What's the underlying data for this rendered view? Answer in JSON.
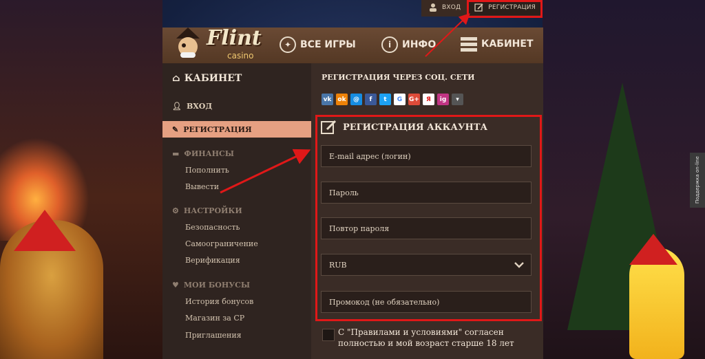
{
  "topbar": {
    "login": "ВХОД",
    "register": "РЕГИСТРАЦИЯ"
  },
  "header": {
    "logo_main": "Flint",
    "logo_sub": "casino",
    "nav": [
      "ВСЕ ИГРЫ",
      "ИНФО",
      "КАБИНЕТ"
    ]
  },
  "sidebar": {
    "title": "КАБИНЕТ",
    "login": "ВХОД",
    "register": "РЕГИСТРАЦИЯ",
    "finance": "ФИНАНСЫ",
    "finance_items": [
      "Пополнить",
      "Вывести"
    ],
    "settings": "НАСТРОЙКИ",
    "settings_items": [
      "Безопасность",
      "Самоограничение",
      "Верификация"
    ],
    "bonuses": "МОИ БОНУСЫ",
    "bonus_items": [
      "История бонусов",
      "Магазин за СР",
      "Приглашения"
    ]
  },
  "social": {
    "title": "РЕГИСТРАЦИЯ ЧЕРЕЗ СОЦ. СЕТИ",
    "networks": [
      {
        "label": "vk",
        "color": "#4a76a8"
      },
      {
        "label": "ok",
        "color": "#ee8208"
      },
      {
        "label": "@",
        "color": "#168de2"
      },
      {
        "label": "f",
        "color": "#3b5998"
      },
      {
        "label": "t",
        "color": "#1da1f2"
      },
      {
        "label": "G",
        "color": "#ffffff"
      },
      {
        "label": "G+",
        "color": "#dd4b39"
      },
      {
        "label": "Я",
        "color": "#ffffff"
      },
      {
        "label": "ig",
        "color": "#c13584"
      },
      {
        "label": "▾",
        "color": "#555555"
      }
    ]
  },
  "form": {
    "title": "РЕГИСТРАЦИЯ АККАУНТА",
    "email": "E-mail адрес (логин)",
    "password": "Пароль",
    "password_repeat": "Повтор пароля",
    "currency": "RUB",
    "promo": "Промокод (не обязательно)",
    "agree": "С \"Правилами и условиями\" согласен полностью и мой возраст старше 18 лет"
  },
  "support": "Поддержка on-line",
  "colors": {
    "accent": "#e6a082",
    "highlight": "#e01818"
  }
}
